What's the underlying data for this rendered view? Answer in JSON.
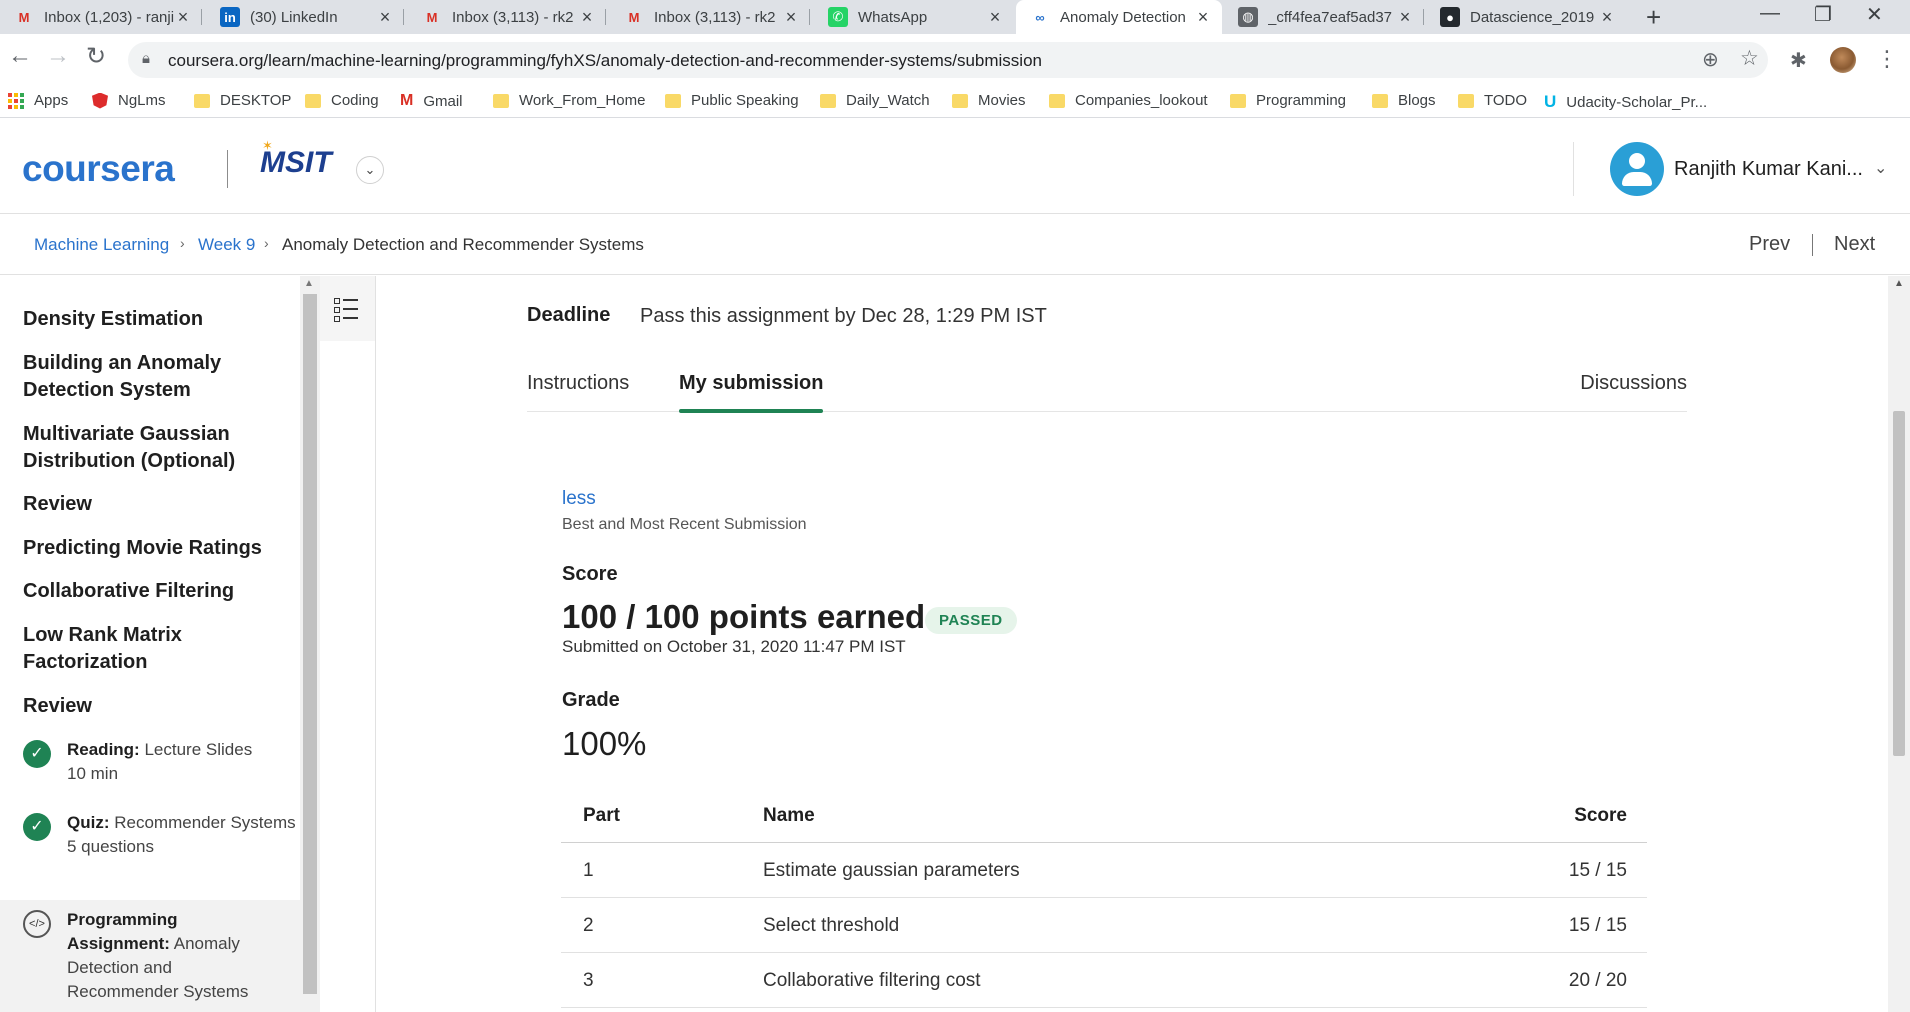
{
  "browser": {
    "tabs": [
      {
        "label": "Inbox (1,203) - ranji",
        "icon": "gmail-icon"
      },
      {
        "label": "(30) LinkedIn",
        "icon": "linkedin-icon"
      },
      {
        "label": "Inbox (3,113) - rk2",
        "icon": "gmail-icon"
      },
      {
        "label": "Inbox (3,113) - rk2",
        "icon": "gmail-icon"
      },
      {
        "label": "WhatsApp",
        "icon": "whatsapp-icon"
      },
      {
        "label": "Anomaly Detection",
        "icon": "coursera-icon"
      },
      {
        "label": "_cff4fea7eaf5ad37",
        "icon": "globe-icon"
      },
      {
        "label": "Datascience_2019",
        "icon": "github-icon"
      }
    ],
    "active_tab_index": 5,
    "url": "coursera.org/learn/machine-learning/programming/fyhXS/anomaly-detection-and-recommender-systems/submission",
    "bookmarks": [
      {
        "label": "Apps",
        "icon": "apps-grid-icon"
      },
      {
        "label": "NgLms",
        "icon": "nglms-icon"
      },
      {
        "label": "DESKTOP",
        "icon": "folder-icon"
      },
      {
        "label": "Coding",
        "icon": "folder-icon"
      },
      {
        "label": "Gmail",
        "icon": "gmail-icon"
      },
      {
        "label": "Work_From_Home",
        "icon": "folder-icon"
      },
      {
        "label": "Public Speaking",
        "icon": "folder-icon"
      },
      {
        "label": "Daily_Watch",
        "icon": "folder-icon"
      },
      {
        "label": "Movies",
        "icon": "folder-icon"
      },
      {
        "label": "Companies_lookout",
        "icon": "folder-icon"
      },
      {
        "label": "Programming",
        "icon": "folder-icon"
      },
      {
        "label": "Blogs",
        "icon": "folder-icon"
      },
      {
        "label": "TODO",
        "icon": "folder-icon"
      },
      {
        "label": "Udacity-Scholar_Pr...",
        "icon": "udacity-icon"
      }
    ]
  },
  "header": {
    "logo": "coursera",
    "org": "MSIT",
    "user_name": "Ranjith Kumar Kani..."
  },
  "breadcrumb": {
    "course": "Machine Learning",
    "week": "Week 9",
    "current": "Anomaly Detection and Recommender Systems",
    "prev": "Prev",
    "next": "Next"
  },
  "sidebar": {
    "headings": [
      "Density Estimation",
      "Building an Anomaly Detection System",
      "Multivariate Gaussian Distribution (Optional)",
      "Review",
      "Predicting Movie Ratings",
      "Collaborative Filtering",
      "Low Rank Matrix Factorization",
      "Review"
    ],
    "items": [
      {
        "type": "Reading:",
        "title": "Lecture Slides",
        "meta": "10 min",
        "status": "completed"
      },
      {
        "type": "Quiz:",
        "title": "Recommender Systems",
        "meta": "5 questions",
        "status": "completed"
      },
      {
        "type": "Programming Assignment:",
        "title": "Anomaly Detection and Recommender Systems",
        "meta": "",
        "status": "current"
      }
    ]
  },
  "assignment": {
    "deadline_label": "Deadline",
    "deadline_value": "Pass this assignment by Dec 28, 1:29 PM IST",
    "tabs": [
      "Instructions",
      "My submission",
      "Discussions"
    ],
    "selected_tab": "My submission",
    "less_link": "less",
    "submission_note": "Best and Most Recent Submission",
    "score_label": "Score",
    "points": "100 / 100 points earned",
    "status_badge": "PASSED",
    "submitted": "Submitted on October 31, 2020 11:47 PM IST",
    "grade_label": "Grade",
    "grade_value": "100%",
    "table": {
      "headers": [
        "Part",
        "Name",
        "Score"
      ],
      "rows": [
        [
          "1",
          "Estimate gaussian parameters",
          "15 / 15"
        ],
        [
          "2",
          "Select threshold",
          "15 / 15"
        ],
        [
          "3",
          "Collaborative filtering cost",
          "20 / 20"
        ]
      ]
    }
  },
  "colors": {
    "brand_blue": "#2a73cc",
    "success_green": "#1f8354",
    "passed_bg": "#e6f4ea"
  }
}
